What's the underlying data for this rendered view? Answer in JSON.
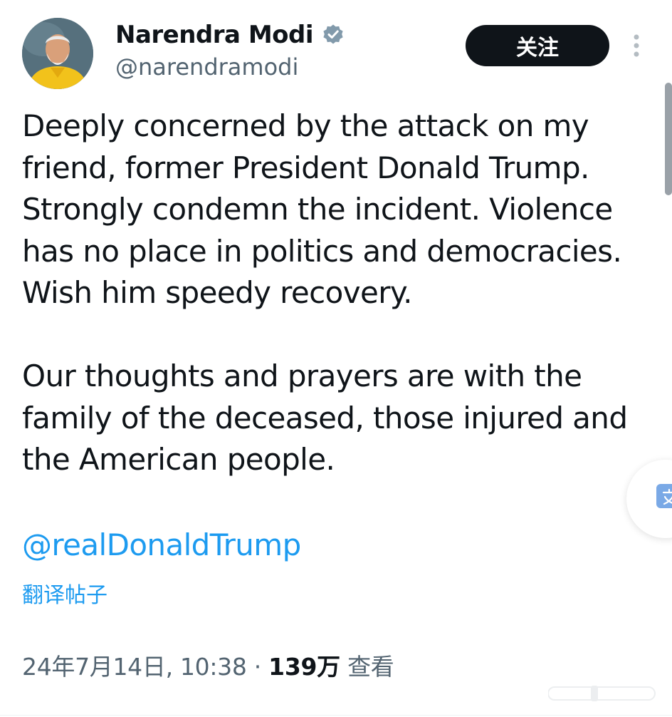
{
  "author": {
    "name": "Narendra Modi",
    "handle": "@narendramodi",
    "verified": true
  },
  "follow_button": {
    "label": "关注"
  },
  "tweet": {
    "paragraphs": [
      [
        "Deeply concerned by the attack on my",
        "friend, former President Donald Trump.",
        "Strongly condemn the incident. Violence",
        "has no place in politics and democracies.",
        "Wish him speedy recovery."
      ],
      [
        "Our thoughts and prayers are with the",
        "family of the deceased, those injured and",
        "the American people."
      ]
    ],
    "mention": "@realDonaldTrump",
    "translate_label": "翻译帖子"
  },
  "meta": {
    "timestamp": "24年7月14日, 10:38",
    "separator": "·",
    "views_count": "139万",
    "views_label": "查看"
  },
  "icons": {
    "verified": "verified-badge-icon",
    "more": "more-vertical-icon",
    "translate": "translate-icon"
  },
  "colors": {
    "link": "#1d9bf0",
    "secondary_text": "#536471",
    "primary_text": "#0f1419",
    "verified_badge": "#829aab",
    "follow_button_bg": "#0f1419"
  }
}
